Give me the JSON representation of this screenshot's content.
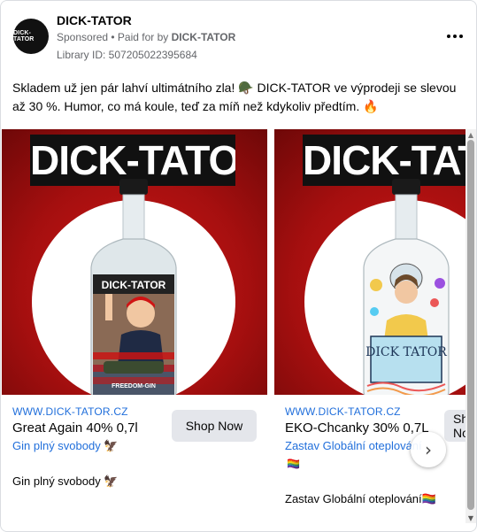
{
  "ad": {
    "avatar_text": "DICK-TATOR",
    "page_name": "DICK-TATOR",
    "sponsored_label": "Sponsored",
    "paid_for_prefix": " • Paid for by ",
    "paid_for_name": "DICK-TATOR",
    "library_id": "Library ID: 507205022395684",
    "body_text": "Skladem už jen pár lahví ultimátního zla! 🪖 DICK-TATOR ve výprodeji se slevou až 30 %. Humor, co má koule, teď za míň než kdykoliv předtím. 🔥"
  },
  "cards": [
    {
      "banner": "DICK-TATOR",
      "url": "WWW.DICK-TATOR.CZ",
      "title": "Great Again 40% 0,7l",
      "subtitle": "Gin plný svobody 🦅",
      "cta": "Shop Now",
      "description": "Gin plný svobody 🦅",
      "label_text": "DICK-TATOR",
      "label_bottom": "FREEDOM-GIN"
    },
    {
      "banner": "DICK-TATOR",
      "url": "WWW.DICK-TATOR.CZ",
      "title": "EKO-Chcanky 30% 0,7L",
      "subtitle": "Zastav Globální oteplování",
      "subtitle_flag": "🏳️‍🌈",
      "cta": "Shop Now",
      "description": "Zastav Globální oteplování🏳️‍🌈",
      "label_text": "DICK TATOR"
    }
  ],
  "icons": {
    "more": "more-horizontal-icon",
    "next": "chevron-right-icon"
  },
  "colors": {
    "link_blue": "#216fdb",
    "banner_red": "#c81414",
    "button_gray": "#e4e6eb"
  }
}
